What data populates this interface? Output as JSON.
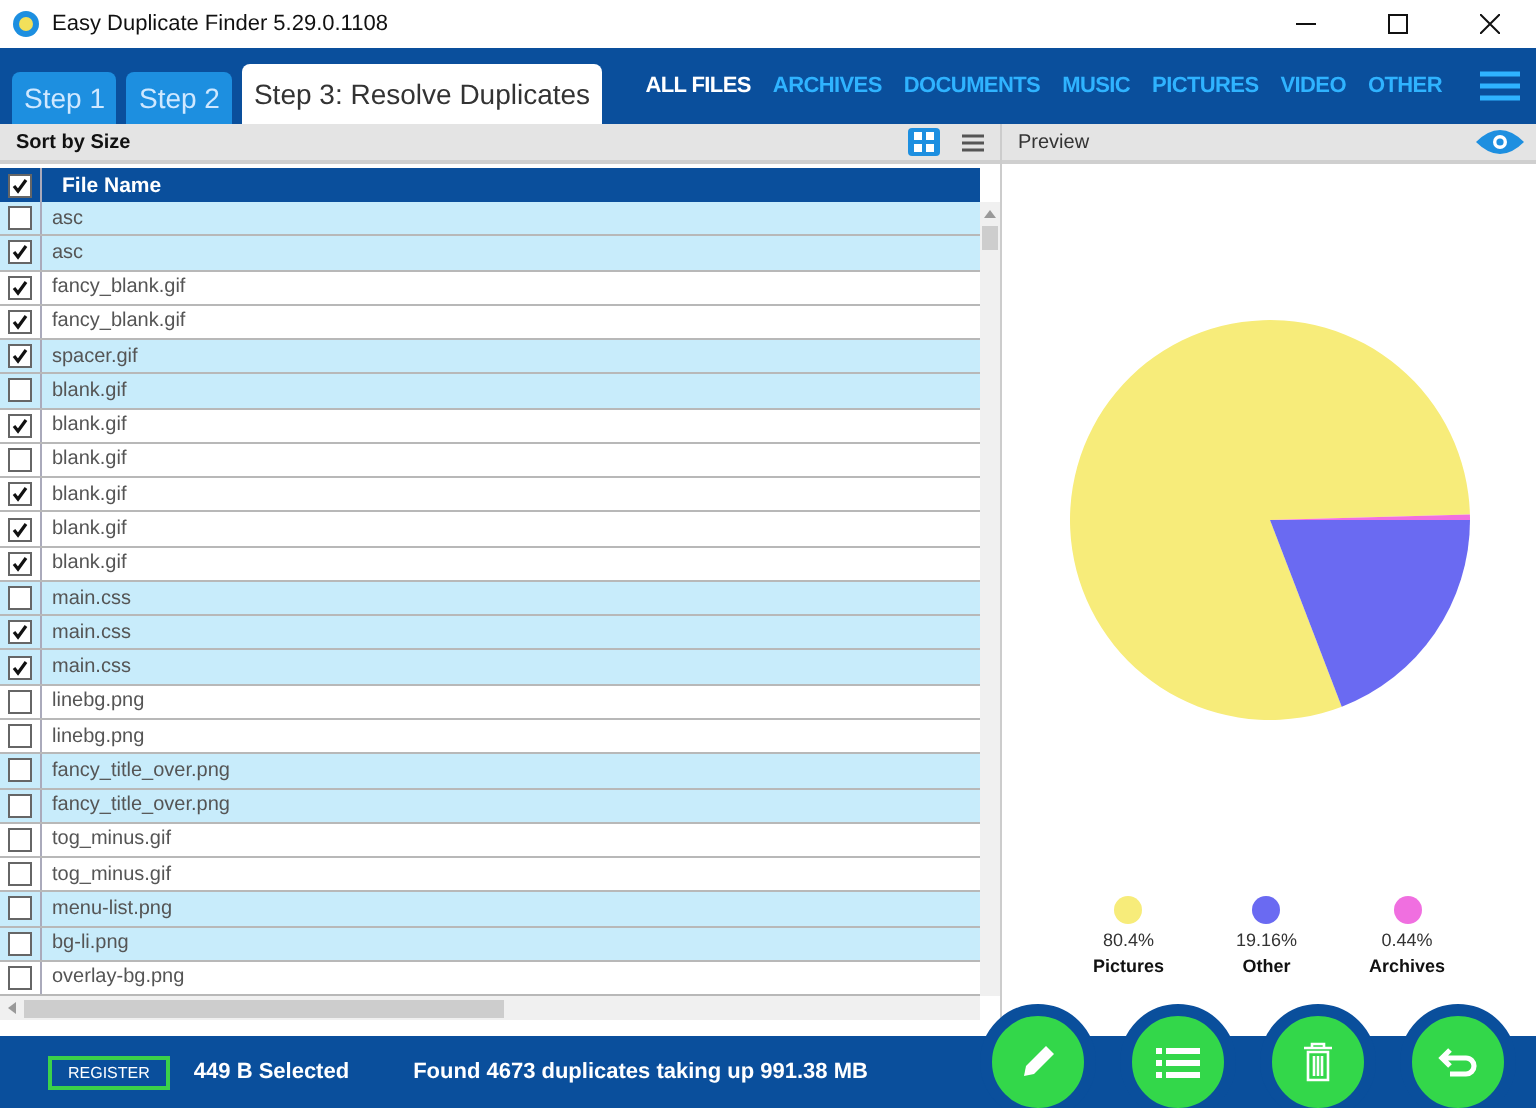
{
  "window": {
    "title": "Easy Duplicate Finder 5.29.0.1108"
  },
  "steps": [
    {
      "label": "Step 1",
      "selected": false
    },
    {
      "label": "Step 2",
      "selected": false
    },
    {
      "label": "Step 3: Resolve Duplicates",
      "selected": true
    }
  ],
  "filters": [
    {
      "label": "ALL FILES",
      "selected": true
    },
    {
      "label": "ARCHIVES",
      "selected": false
    },
    {
      "label": "DOCUMENTS",
      "selected": false
    },
    {
      "label": "MUSIC",
      "selected": false
    },
    {
      "label": "PICTURES",
      "selected": false
    },
    {
      "label": "VIDEO",
      "selected": false
    },
    {
      "label": "OTHER",
      "selected": false
    }
  ],
  "toolbar": {
    "sort_label": "Sort by Size",
    "views": [
      {
        "kind": "grid",
        "selected": true
      },
      {
        "kind": "list",
        "selected": false
      }
    ]
  },
  "preview": {
    "title": "Preview"
  },
  "table": {
    "all_checked": true,
    "column": "File Name",
    "groups": [
      {
        "rows": [
          {
            "name": "asc",
            "checked": false
          },
          {
            "name": "asc",
            "checked": true
          }
        ]
      },
      {
        "rows": [
          {
            "name": "fancy_blank.gif",
            "checked": true
          },
          {
            "name": "fancy_blank.gif",
            "checked": true
          }
        ]
      },
      {
        "rows": [
          {
            "name": "spacer.gif",
            "checked": true
          },
          {
            "name": "blank.gif",
            "checked": false
          }
        ]
      },
      {
        "rows": [
          {
            "name": "blank.gif",
            "checked": true
          },
          {
            "name": "blank.gif",
            "checked": false
          },
          {
            "name": "blank.gif",
            "checked": true
          },
          {
            "name": "blank.gif",
            "checked": true
          },
          {
            "name": "blank.gif",
            "checked": true
          }
        ]
      },
      {
        "rows": [
          {
            "name": "main.css",
            "checked": false
          },
          {
            "name": "main.css",
            "checked": true
          },
          {
            "name": "main.css",
            "checked": true
          }
        ]
      },
      {
        "rows": [
          {
            "name": "linebg.png",
            "checked": false
          },
          {
            "name": "linebg.png",
            "checked": false
          }
        ]
      },
      {
        "rows": [
          {
            "name": "fancy_title_over.png",
            "checked": false
          },
          {
            "name": "fancy_title_over.png",
            "checked": false
          }
        ]
      },
      {
        "rows": [
          {
            "name": "tog_minus.gif",
            "checked": false
          },
          {
            "name": "tog_minus.gif",
            "checked": false
          }
        ]
      },
      {
        "rows": [
          {
            "name": "menu-list.png",
            "checked": false
          },
          {
            "name": "bg-li.png",
            "checked": false
          }
        ]
      },
      {
        "rows": [
          {
            "name": "overlay-bg.png",
            "checked": false
          }
        ]
      }
    ]
  },
  "chart_data": {
    "type": "pie",
    "categories": [
      "Pictures",
      "Other",
      "Archives"
    ],
    "values": [
      80.4,
      19.16,
      0.44
    ],
    "colors": [
      "#f7ec7a",
      "#6a6af2",
      "#f06fe0"
    ],
    "value_labels": [
      "80.4%",
      "19.16%",
      "0.44%"
    ]
  },
  "status": {
    "badge": "REGISTER",
    "selected": "449 B Selected",
    "summary": "Found 4673 duplicates taking up 991.38 MB"
  },
  "actions": [
    {
      "kind": "edit"
    },
    {
      "kind": "list"
    },
    {
      "kind": "delete"
    },
    {
      "kind": "undo"
    }
  ]
}
